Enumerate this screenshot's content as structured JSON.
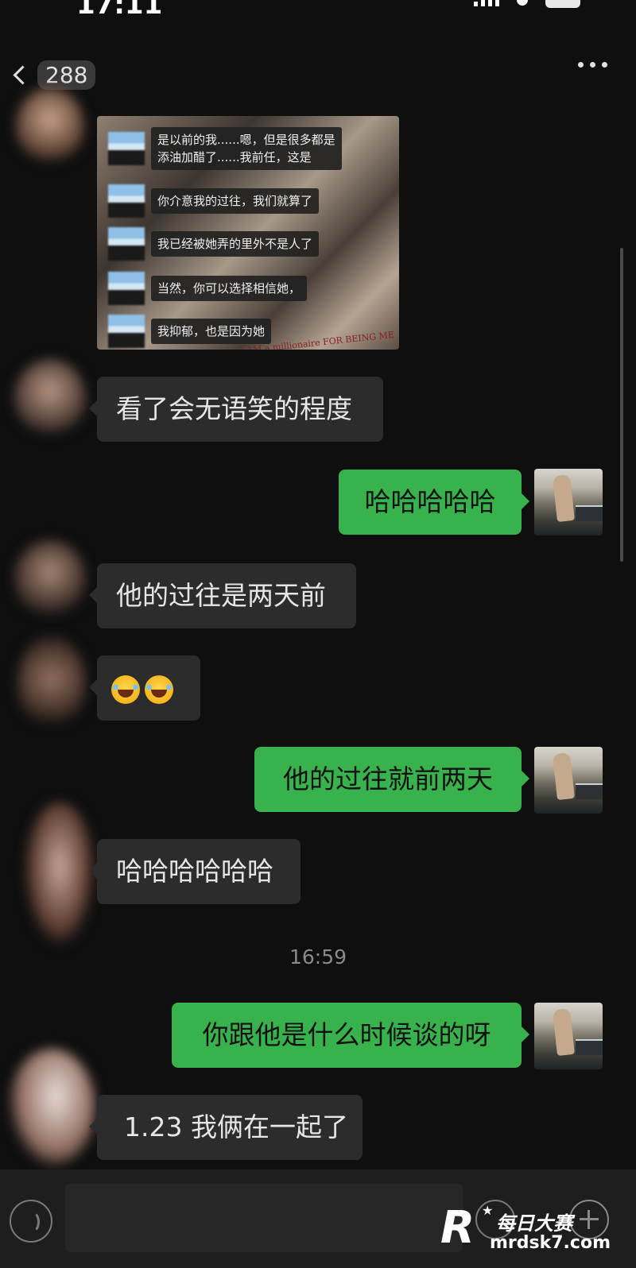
{
  "status_bar": {
    "time": "17:11",
    "battery_level": ""
  },
  "nav": {
    "unread_count": "288"
  },
  "image_message": {
    "lines": [
      "是以前的我......嗯，但是很多都是\n添油加醋了......我前任，这是",
      "你介意我的过往，我们就算了",
      "我已经被她弄的里外不是人了",
      "当然，你可以选择相信她，",
      "我抑郁，也是因为她"
    ],
    "caption": "I AM a millionaire FOR BEING ME"
  },
  "messages": [
    {
      "side": "in",
      "text": "看了会无语笑的程度"
    },
    {
      "side": "out",
      "text": "哈哈哈哈哈"
    },
    {
      "side": "in",
      "text": "他的过往是两天前"
    },
    {
      "side": "in",
      "text": "",
      "emoji": [
        "face-with-tears-of-joy-icon",
        "face-with-tears-of-joy-icon"
      ]
    },
    {
      "side": "out",
      "text": "他的过往就前两天"
    },
    {
      "side": "in",
      "text": "哈哈哈哈哈哈"
    },
    {
      "side": "out",
      "text": "你跟他是什么时候谈的呀"
    },
    {
      "side": "in",
      "text": "1.23 我俩在一起了"
    }
  ],
  "timestamp": "16:59",
  "watermark": {
    "brand_cn": "每日大赛",
    "url": "mrdsk7.com",
    "logo_letter": "R"
  }
}
